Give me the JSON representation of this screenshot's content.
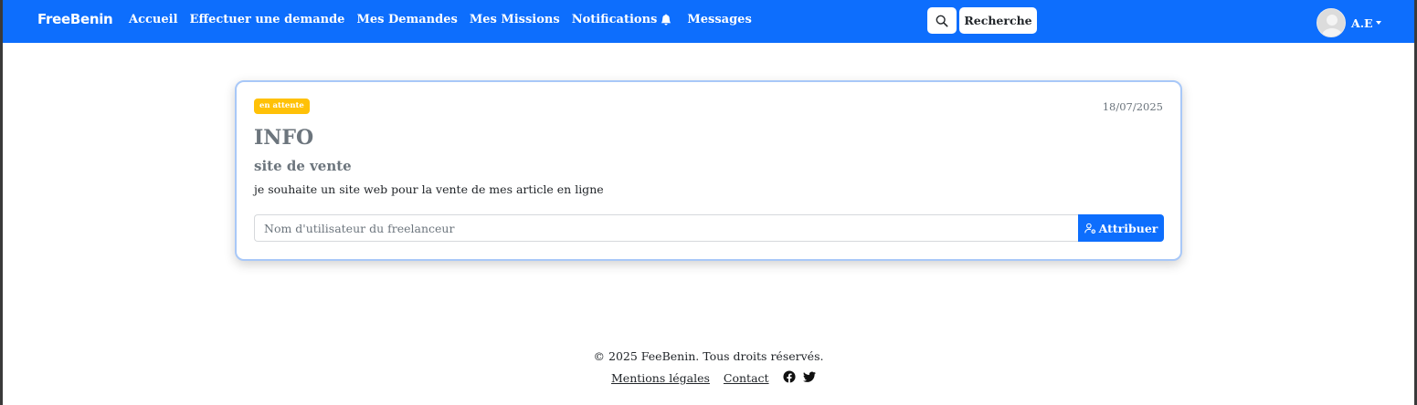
{
  "navbar": {
    "brand": "FreeBenin",
    "links": [
      {
        "label": "Accueil"
      },
      {
        "label": "Effectuer une demande"
      },
      {
        "label": "Mes Demandes"
      },
      {
        "label": "Mes Missions"
      },
      {
        "label": "Notifications"
      },
      {
        "label": "Messages"
      }
    ],
    "search_icon": "search-icon",
    "search_button_label": "Recherche",
    "user_initials": "A.E",
    "accent_color": "#0d6efd"
  },
  "card": {
    "status_badge": "en attente",
    "status_color": "#ffc107",
    "date": "18/07/2025",
    "title": "INFO",
    "subtitle": "site de vente",
    "description": "je souhaite un site web pour la vente de mes article en ligne",
    "input_placeholder": "Nom d'utilisateur du freelanceur",
    "assign_button_label": "Attribuer",
    "assign_icon": "user-gear-icon"
  },
  "footer": {
    "copyright": "© 2025 FeeBenin. Tous droits réservés.",
    "links": [
      {
        "label": "Mentions légales"
      },
      {
        "label": "Contact"
      }
    ],
    "social_icons": [
      "facebook-icon",
      "twitter-icon"
    ]
  }
}
